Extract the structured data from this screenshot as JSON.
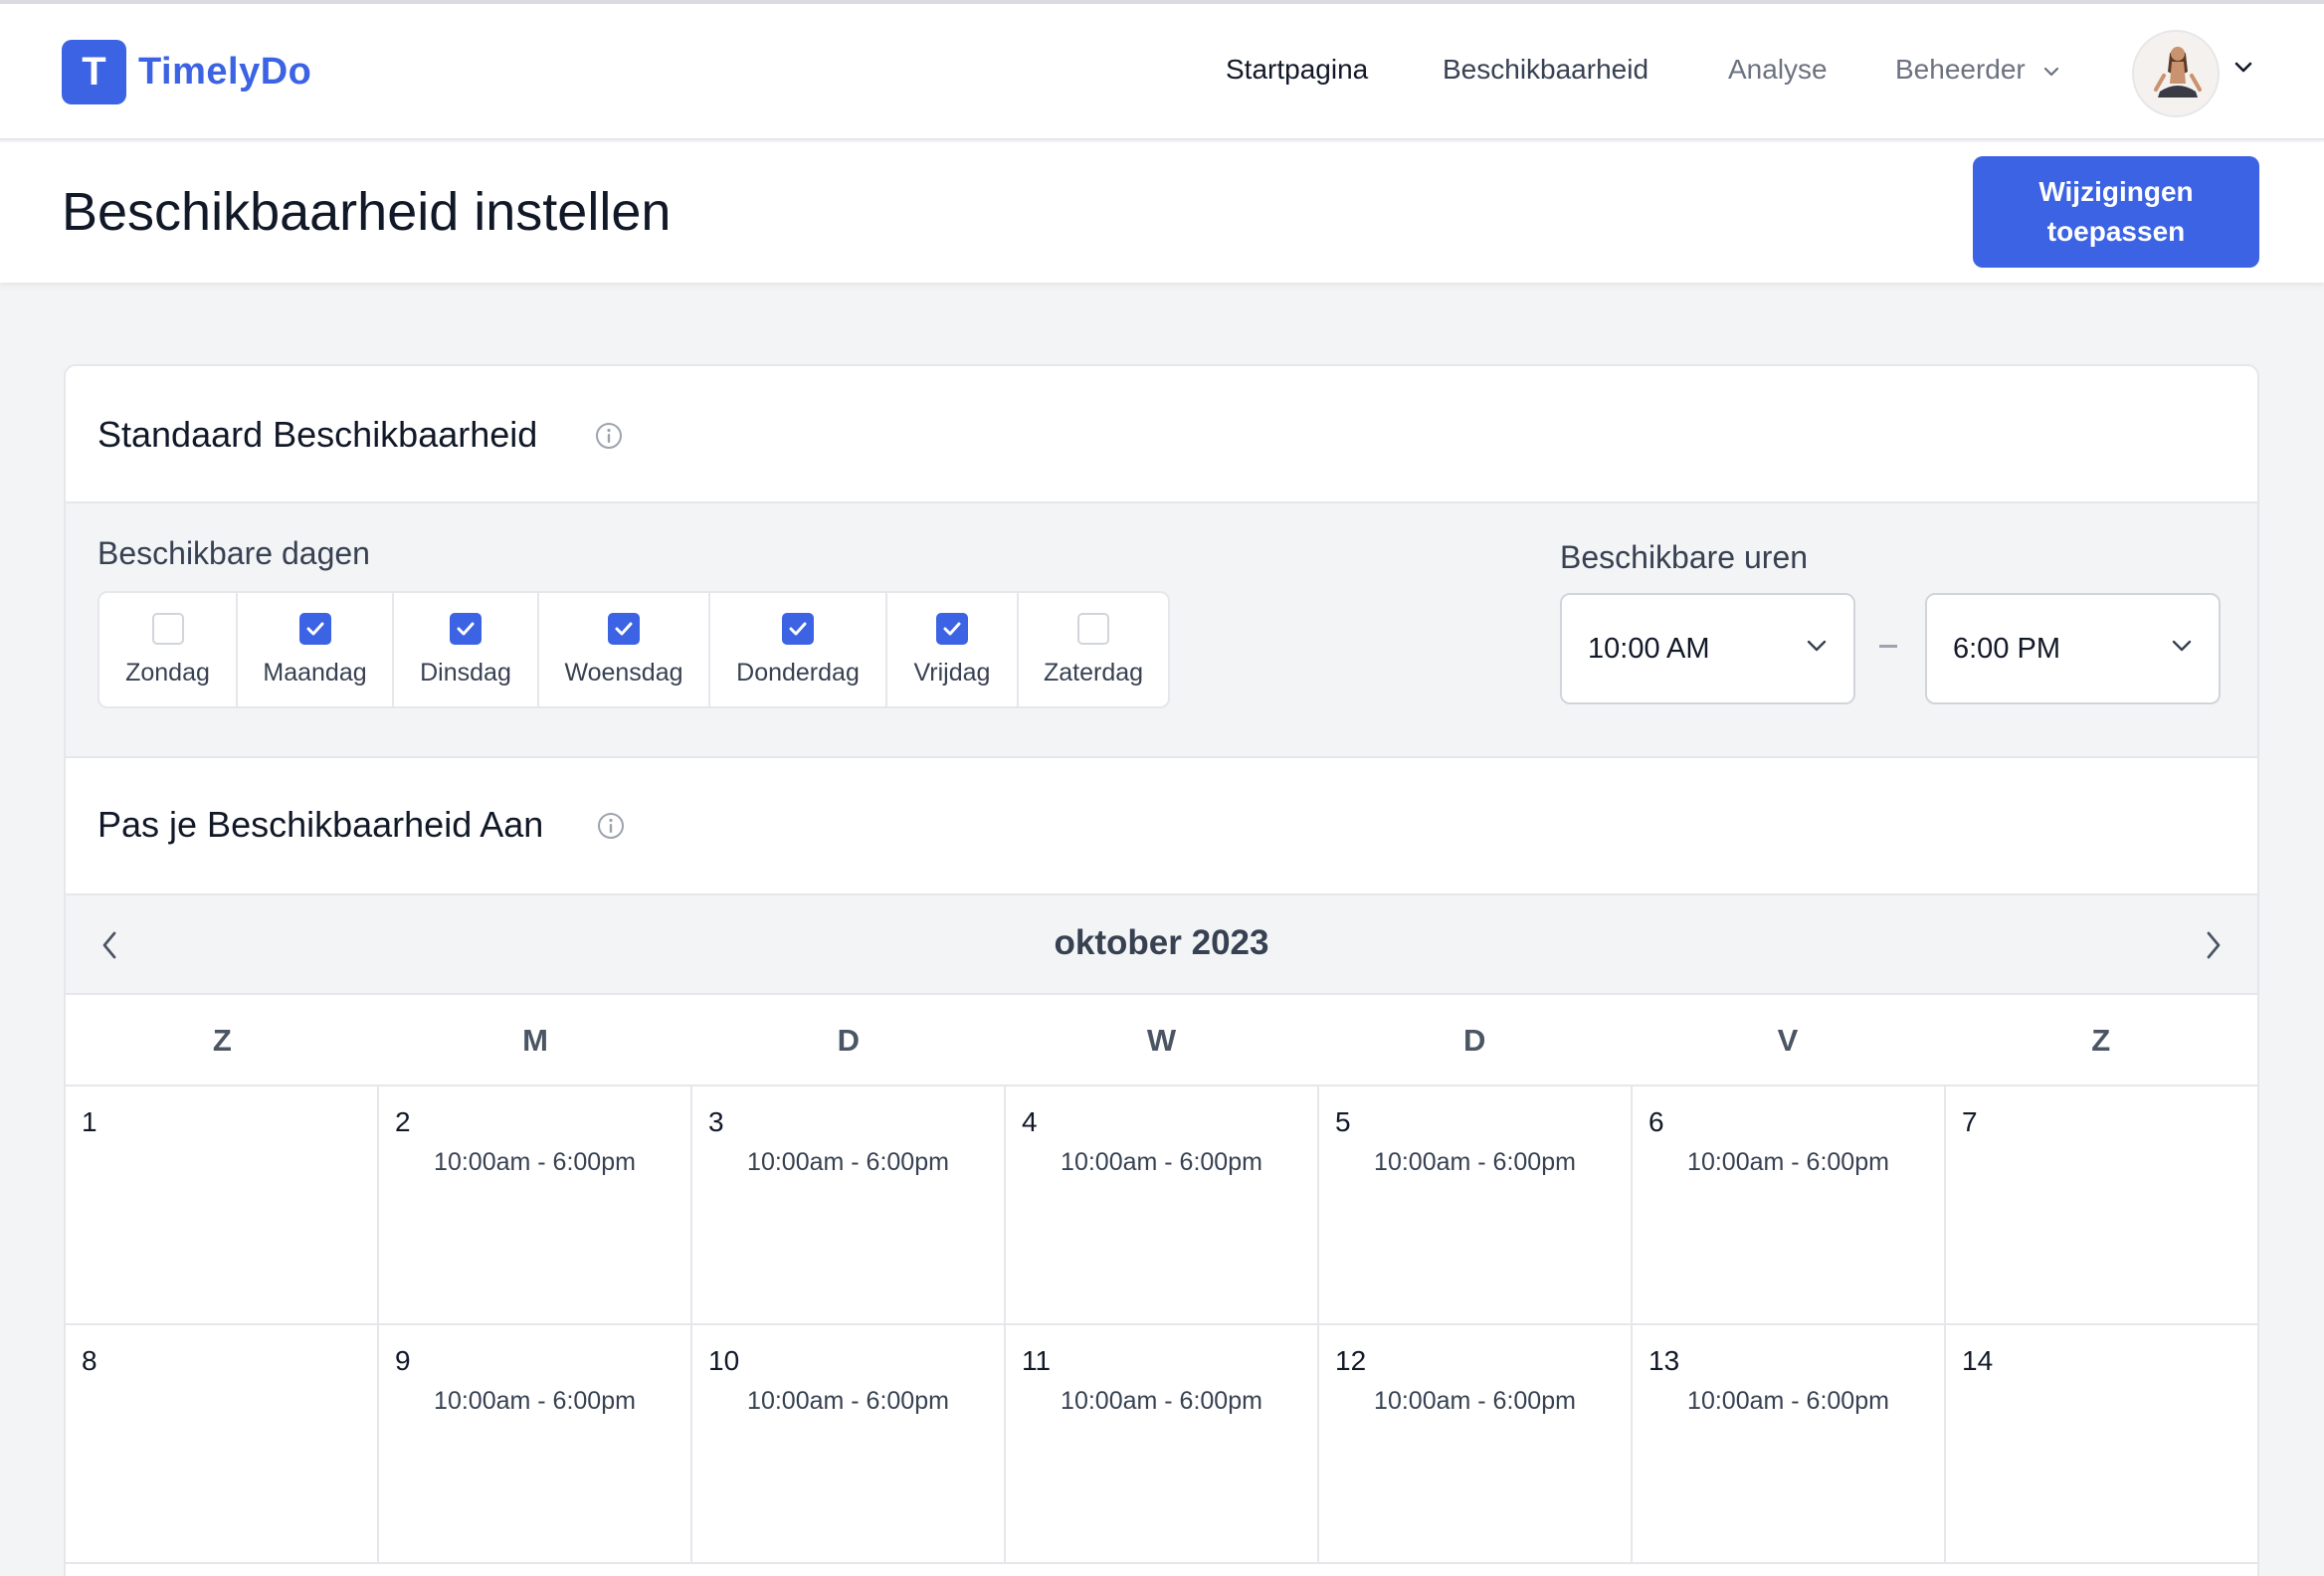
{
  "brand": {
    "letter": "T",
    "name": "TimelyDo"
  },
  "nav": {
    "links": [
      {
        "label": "Startpagina"
      },
      {
        "label": "Beschikbaarheid"
      },
      {
        "label": "Analyse"
      },
      {
        "label": "Beheerder"
      }
    ]
  },
  "page": {
    "title": "Beschikbaarheid instellen",
    "apply_label": "Wijzigingen toepassen"
  },
  "standard": {
    "title": "Standaard Beschikbaarheid",
    "days_label": "Beschikbare dagen",
    "hours_label": "Beschikbare uren",
    "days": [
      {
        "label": "Zondag",
        "checked": false
      },
      {
        "label": "Maandag",
        "checked": true
      },
      {
        "label": "Dinsdag",
        "checked": true
      },
      {
        "label": "Woensdag",
        "checked": true
      },
      {
        "label": "Donderdag",
        "checked": true
      },
      {
        "label": "Vrijdag",
        "checked": true
      },
      {
        "label": "Zaterdag",
        "checked": false
      }
    ],
    "start_time": "10:00 AM",
    "end_time": "6:00 PM"
  },
  "adjust": {
    "title": "Pas je Beschikbaarheid Aan"
  },
  "calendar": {
    "month": "oktober 2023",
    "weekdays": [
      "Z",
      "M",
      "D",
      "W",
      "D",
      "V",
      "Z"
    ],
    "days": [
      {
        "day": "1",
        "hours": ""
      },
      {
        "day": "2",
        "hours": "10:00am - 6:00pm"
      },
      {
        "day": "3",
        "hours": "10:00am - 6:00pm"
      },
      {
        "day": "4",
        "hours": "10:00am - 6:00pm"
      },
      {
        "day": "5",
        "hours": "10:00am - 6:00pm"
      },
      {
        "day": "6",
        "hours": "10:00am - 6:00pm"
      },
      {
        "day": "7",
        "hours": ""
      },
      {
        "day": "8",
        "hours": ""
      },
      {
        "day": "9",
        "hours": "10:00am - 6:00pm"
      },
      {
        "day": "10",
        "hours": "10:00am - 6:00pm"
      },
      {
        "day": "11",
        "hours": "10:00am - 6:00pm"
      },
      {
        "day": "12",
        "hours": "10:00am - 6:00pm"
      },
      {
        "day": "13",
        "hours": "10:00am - 6:00pm"
      },
      {
        "day": "14",
        "hours": ""
      }
    ]
  },
  "colors": {
    "accent": "#3b63e4",
    "border": "#e5e7eb",
    "muted_bg": "#f3f4f6"
  }
}
